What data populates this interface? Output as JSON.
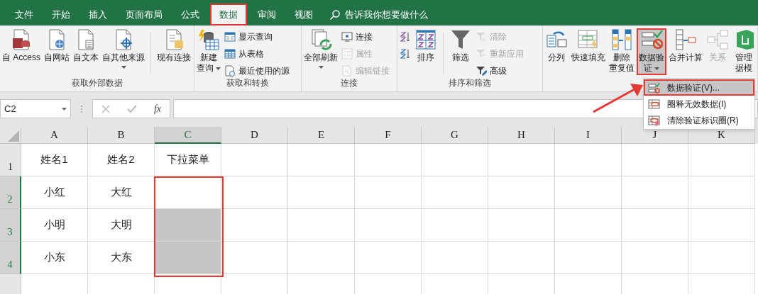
{
  "tabs": [
    {
      "label": "文件",
      "selected": false
    },
    {
      "label": "开始",
      "selected": false
    },
    {
      "label": "插入",
      "selected": false
    },
    {
      "label": "页面布局",
      "selected": false
    },
    {
      "label": "公式",
      "selected": false
    },
    {
      "label": "数据",
      "selected": true
    },
    {
      "label": "审阅",
      "selected": false
    },
    {
      "label": "视图",
      "selected": false
    }
  ],
  "search": {
    "placeholder": "告诉我你想要做什么"
  },
  "ribbon_groups": [
    {
      "label": "获取外部数据",
      "items": [
        {
          "kind": "large",
          "lines": [
            "自 Access"
          ],
          "dropdown": false,
          "pressed": false,
          "disabled": false
        },
        {
          "kind": "large",
          "lines": [
            "自网站"
          ],
          "dropdown": false,
          "pressed": false,
          "disabled": false
        },
        {
          "kind": "large",
          "lines": [
            "自文本"
          ],
          "dropdown": false,
          "pressed": false,
          "disabled": false
        },
        {
          "kind": "large",
          "lines": [
            "自其他来源"
          ],
          "dropdown": true,
          "pressed": false,
          "disabled": false
        },
        {
          "kind": "divider"
        },
        {
          "kind": "large",
          "lines": [
            "现有连接"
          ],
          "dropdown": false,
          "pressed": false,
          "disabled": false
        }
      ]
    },
    {
      "label": "获取和转换",
      "items": [
        {
          "kind": "large",
          "lines": [
            "新建",
            "查询"
          ],
          "dropdown": true,
          "pressed": false,
          "disabled": false
        },
        {
          "kind": "stack",
          "buttons": [
            {
              "label": "显示查询",
              "disabled": false
            },
            {
              "label": "从表格",
              "disabled": false
            },
            {
              "label": "最近使用的源",
              "disabled": false
            }
          ]
        }
      ]
    },
    {
      "label": "连接",
      "items": [
        {
          "kind": "large",
          "lines": [
            "全部刷新"
          ],
          "dropdown": true,
          "pressed": false,
          "disabled": false
        },
        {
          "kind": "stack",
          "buttons": [
            {
              "label": "连接",
              "disabled": false
            },
            {
              "label": "属性",
              "disabled": true
            },
            {
              "label": "编辑链接",
              "disabled": true
            }
          ]
        }
      ]
    },
    {
      "label": "排序和筛选",
      "items": [
        {
          "kind": "stack",
          "buttons": [
            {
              "disabled": false
            },
            {
              "disabled": false
            }
          ]
        },
        {
          "kind": "large",
          "lines": [
            "排序"
          ],
          "dropdown": false,
          "pressed": false,
          "disabled": false
        },
        {
          "kind": "divider"
        },
        {
          "kind": "large",
          "lines": [
            "筛选"
          ],
          "dropdown": false,
          "pressed": false,
          "disabled": false
        },
        {
          "kind": "stack",
          "buttons": [
            {
              "label": "清除",
              "disabled": true
            },
            {
              "label": "重新应用",
              "disabled": true
            },
            {
              "label": "高级",
              "disabled": false
            }
          ]
        }
      ]
    },
    {
      "items": [
        {
          "kind": "large",
          "lines": [
            "分列"
          ],
          "dropdown": false,
          "pressed": false,
          "disabled": false
        },
        {
          "kind": "large",
          "lines": [
            "快速填充"
          ],
          "dropdown": false,
          "pressed": false,
          "disabled": false
        },
        {
          "kind": "large",
          "lines": [
            "删除",
            "重复值"
          ],
          "dropdown": false,
          "pressed": false,
          "disabled": false
        },
        {
          "kind": "large",
          "lines": [
            "数据验",
            "证"
          ],
          "dropdown": true,
          "pressed": true,
          "disabled": false
        },
        {
          "kind": "large",
          "lines": [
            "合并计算"
          ],
          "dropdown": false,
          "pressed": false,
          "disabled": false
        },
        {
          "kind": "large",
          "lines": [
            "关系"
          ],
          "dropdown": false,
          "pressed": false,
          "disabled": true
        },
        {
          "kind": "large",
          "lines": [
            "管理",
            "据模"
          ],
          "dropdown": false,
          "pressed": false,
          "disabled": false
        }
      ]
    }
  ],
  "formula_bar": {
    "name_box": "C2",
    "fx": "fx"
  },
  "columns": [
    {
      "label": "A",
      "selected": false
    },
    {
      "label": "B",
      "selected": false
    },
    {
      "label": "C",
      "selected": true
    },
    {
      "label": "D",
      "selected": false
    },
    {
      "label": "E",
      "selected": false
    },
    {
      "label": "F",
      "selected": false
    },
    {
      "label": "G",
      "selected": false
    },
    {
      "label": "H",
      "selected": false
    },
    {
      "label": "I",
      "selected": false
    },
    {
      "label": "J",
      "selected": false
    },
    {
      "label": "K",
      "selected": false
    }
  ],
  "rows": [
    {
      "header": "1",
      "selected": false,
      "cells": [
        {
          "text": "姓名1",
          "selected": false
        },
        {
          "text": "姓名2",
          "selected": false
        },
        {
          "text": "下拉菜单",
          "selected": false
        }
      ]
    },
    {
      "header": "2",
      "selected": true,
      "cells": [
        {
          "text": "小红",
          "selected": false
        },
        {
          "text": "大红",
          "selected": false
        },
        {
          "selected": false
        }
      ]
    },
    {
      "header": "3",
      "selected": true,
      "cells": [
        {
          "text": "小明",
          "selected": false
        },
        {
          "text": "大明",
          "selected": false
        },
        {
          "selected": true
        }
      ]
    },
    {
      "header": "4",
      "selected": true,
      "cells": [
        {
          "text": "小东",
          "selected": false
        },
        {
          "text": "大东",
          "selected": false
        },
        {
          "selected": true
        }
      ]
    }
  ],
  "dropdown_menu": [
    {
      "label": "数据验证(V)...",
      "selected": true
    },
    {
      "label": "圈释无效数据(I)",
      "selected": false
    },
    {
      "label": "清除验证标识圈(R)",
      "selected": false
    }
  ]
}
